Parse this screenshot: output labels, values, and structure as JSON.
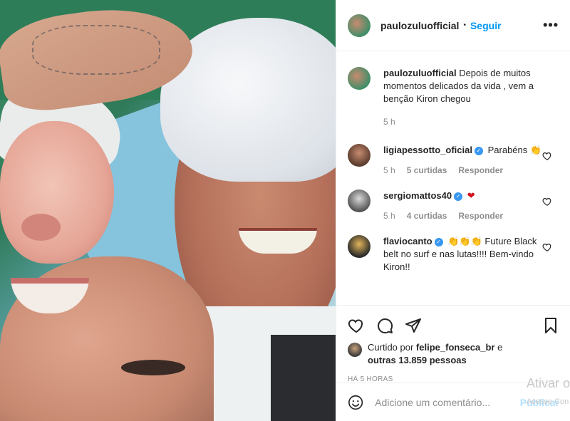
{
  "post": {
    "username": "paulozuluofficial",
    "follow_label": "Seguir",
    "more_label": "•••",
    "caption": {
      "username": "paulozuluofficial",
      "text": "Depois de muitos momentos delicados da vida , vem a benção Kiron chegou",
      "time": "5 h"
    }
  },
  "comments": [
    {
      "username": "ligiapessotto_oficial",
      "verified": true,
      "text": "Parabéns 👏",
      "time": "5 h",
      "likes": "5 curtidas",
      "reply": "Responder"
    },
    {
      "username": "sergiomattos40",
      "verified": true,
      "text": "❤",
      "time": "5 h",
      "likes": "4 curtidas",
      "reply": "Responder"
    },
    {
      "username": "flaviocanto",
      "verified": true,
      "text": "👏👏👏 Future Black belt no surf e nas lutas!!!! Bem-vindo Kiron!!"
    }
  ],
  "likes": {
    "prefix": "Curtido por",
    "user": "felipe_fonseca_br",
    "conj": "e",
    "others": "outras 13.859 pessoas"
  },
  "posted_ago": "HÁ 5 HORAS",
  "add_comment": {
    "placeholder": "Adicione um comentário...",
    "publish": "Publicar"
  },
  "watermark": {
    "title": "Ativar o",
    "sub": "Acesse Con"
  },
  "colors": {
    "accent": "#0095f6",
    "verified": "#3897f0",
    "muted": "#8e8e8e"
  }
}
